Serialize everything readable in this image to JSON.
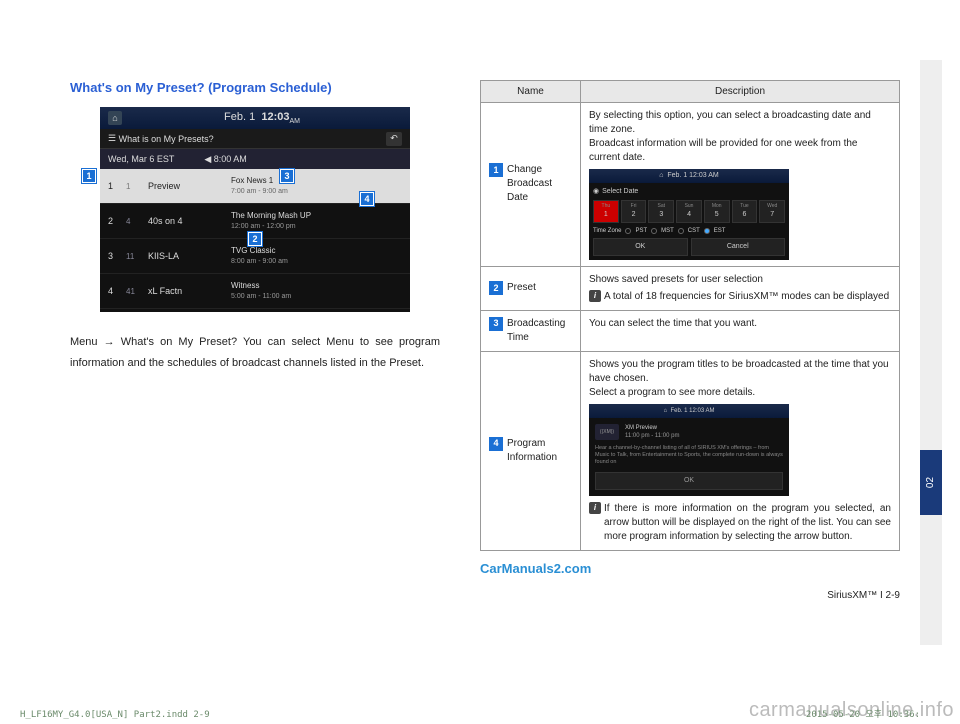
{
  "heading": "What's on My Preset? (Program Schedule)",
  "screenshot": {
    "date_header": "Feb.  1",
    "time": "12:03",
    "ampm": "AM",
    "subtitle": "What is on My Presets?",
    "date_row": "Wed, Mar 6 EST",
    "time_slot": "8:00 AM",
    "rows": [
      {
        "idx": "1",
        "ch": "1",
        "station": "Preview",
        "program": "Fox News 1",
        "time": "7:00 am - 9:00 am"
      },
      {
        "idx": "2",
        "ch": "4",
        "station": "40s on 4",
        "program": "The Morning Mash UP",
        "time": "12:00 am - 12:00 pm"
      },
      {
        "idx": "3",
        "ch": "11",
        "station": "KIIS-LA",
        "program": "TVG Classic",
        "time": "8:00 am - 9:00 am"
      },
      {
        "idx": "4",
        "ch": "41",
        "station": "xL Factn",
        "program": "Witness",
        "time": "5:00 am - 11:00 am"
      }
    ]
  },
  "callouts": {
    "c1": "1",
    "c2": "2",
    "c3": "3",
    "c4": "4"
  },
  "paragraph": "Menu → What's on My Preset? You can select Menu to see program information and the schedules of broadcast channels listed in the Preset.",
  "table": {
    "header_name": "Name",
    "header_desc": "Description",
    "r1": {
      "name": "Change Broadcast Date",
      "desc": "By selecting this option, you can select a broadcasting date and time zone.\nBroadcast information will be provided for one week from the current date."
    },
    "r2": {
      "name": "Preset",
      "desc": "Shows saved presets for user selection",
      "note": "A total of 18 frequencies for SiriusXM™ modes can be displayed"
    },
    "r3": {
      "name": "Broadcasting Time",
      "desc": "You can select the time that you want."
    },
    "r4": {
      "name": "Program Information",
      "desc": "Shows you the program titles to be broadcasted at the time that you have chosen.\nSelect a program to see more details.",
      "note": "If there is more information on the program you selected, an arrow button will be displayed on the right of the list. You can see more program information by selecting the arrow button."
    }
  },
  "mini_date": {
    "title": "Select Date",
    "top_time": "Feb. 1  12:03 AM",
    "days": [
      {
        "d": "Thu",
        "n": "1"
      },
      {
        "d": "Fri",
        "n": "2"
      },
      {
        "d": "Sat",
        "n": "3"
      },
      {
        "d": "Sun",
        "n": "4"
      },
      {
        "d": "Mon",
        "n": "5"
      },
      {
        "d": "Tue",
        "n": "6"
      },
      {
        "d": "Wed",
        "n": "7"
      }
    ],
    "tz_label": "Time Zone",
    "tz": [
      "PST",
      "MST",
      "CST",
      "EST"
    ],
    "ok": "OK",
    "cancel": "Cancel"
  },
  "mini_prog": {
    "top_time": "Feb. 1  12:03 AM",
    "title": "XM Preview",
    "sub": "11:00 pm - 11:00 pm",
    "body": "Hear a channel-by-channel listing of all of SIRIUS XM's offerings – from Music to Talk, from Entertainment to Sports, the complete run-down is always found on",
    "ok": "OK"
  },
  "footer_link": "CarManuals2.com",
  "footer_right": "SiriusXM™ I 2-9",
  "watermark": "carmanualsonline.info",
  "print_left": "H_LF16MY_G4.0[USA_N] Part2.indd   2-9",
  "print_right": "2015-05-20   오후 10:36:",
  "side_tab": "02"
}
